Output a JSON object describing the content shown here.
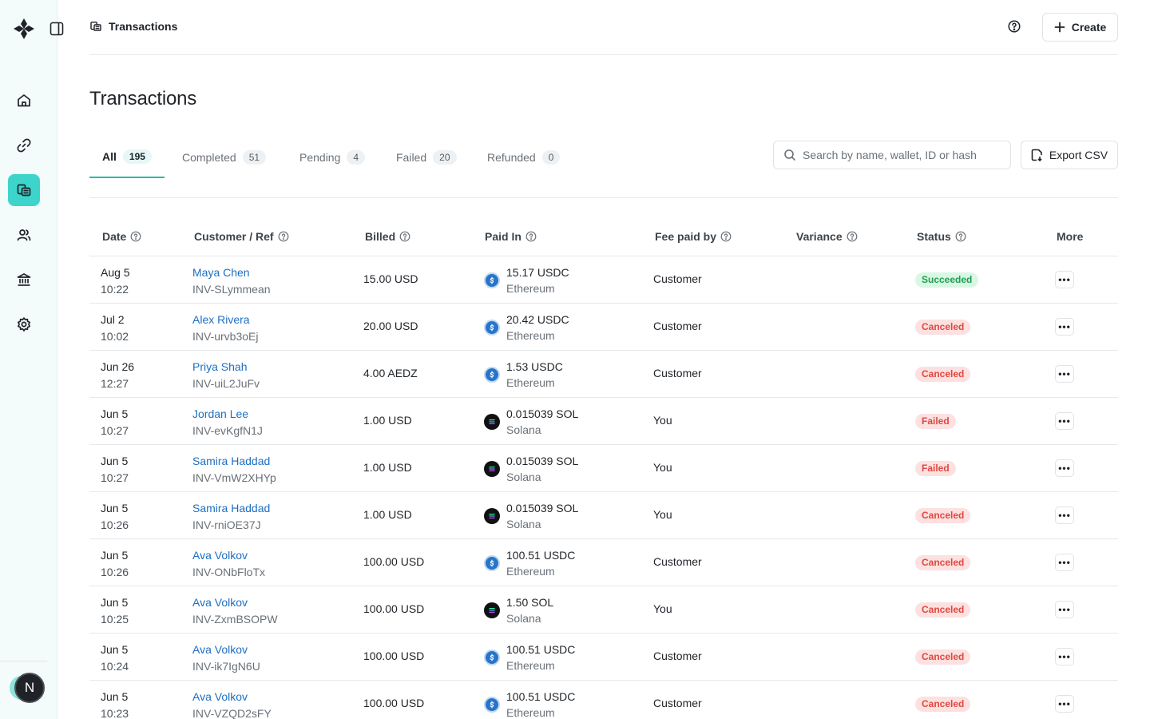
{
  "header": {
    "breadcrumb": "Transactions",
    "create_label": "Create"
  },
  "page": {
    "title": "Transactions"
  },
  "tabs": [
    {
      "label": "All",
      "count": "195",
      "active": true
    },
    {
      "label": "Completed",
      "count": "51",
      "active": false
    },
    {
      "label": "Pending",
      "count": "4",
      "active": false
    },
    {
      "label": "Failed",
      "count": "20",
      "active": false
    },
    {
      "label": "Refunded",
      "count": "0",
      "active": false
    }
  ],
  "search": {
    "placeholder": "Search by name, wallet, ID or hash",
    "value": ""
  },
  "export_label": "Export CSV",
  "user": {
    "initial": "N"
  },
  "table": {
    "columns": [
      "Date",
      "Customer / Ref",
      "Billed",
      "Paid In",
      "Fee paid by",
      "Variance",
      "Status",
      "More"
    ],
    "rows": [
      {
        "date": "Aug 5",
        "time": "10:22",
        "customer": "Maya Chen",
        "ref": "INV-SLymmean",
        "billed": "15.00 USD",
        "coin": "usdc",
        "paid": "15.17 USDC",
        "chain": "Ethereum",
        "fee": "Customer",
        "variance": "",
        "status": "Succeeded"
      },
      {
        "date": "Jul 2",
        "time": "10:02",
        "customer": "Alex Rivera",
        "ref": "INV-urvb3oEj",
        "billed": "20.00 USD",
        "coin": "usdc",
        "paid": "20.42 USDC",
        "chain": "Ethereum",
        "fee": "Customer",
        "variance": "",
        "status": "Canceled"
      },
      {
        "date": "Jun 26",
        "time": "12:27",
        "customer": "Priya Shah",
        "ref": "INV-uiL2JuFv",
        "billed": "4.00 AEDZ",
        "coin": "usdc",
        "paid": "1.53 USDC",
        "chain": "Ethereum",
        "fee": "Customer",
        "variance": "",
        "status": "Canceled"
      },
      {
        "date": "Jun 5",
        "time": "10:27",
        "customer": "Jordan Lee",
        "ref": "INV-evKgfN1J",
        "billed": "1.00 USD",
        "coin": "sol",
        "paid": "0.015039 SOL",
        "chain": "Solana",
        "fee": "You",
        "variance": "",
        "status": "Failed"
      },
      {
        "date": "Jun 5",
        "time": "10:27",
        "customer": "Samira Haddad",
        "ref": "INV-VmW2XHYp",
        "billed": "1.00 USD",
        "coin": "sol",
        "paid": "0.015039 SOL",
        "chain": "Solana",
        "fee": "You",
        "variance": "",
        "status": "Failed"
      },
      {
        "date": "Jun 5",
        "time": "10:26",
        "customer": "Samira Haddad",
        "ref": "INV-rniOE37J",
        "billed": "1.00 USD",
        "coin": "sol",
        "paid": "0.015039 SOL",
        "chain": "Solana",
        "fee": "You",
        "variance": "",
        "status": "Canceled"
      },
      {
        "date": "Jun 5",
        "time": "10:26",
        "customer": "Ava Volkov",
        "ref": "INV-ONbFloTx",
        "billed": "100.00 USD",
        "coin": "usdc",
        "paid": "100.51 USDC",
        "chain": "Ethereum",
        "fee": "Customer",
        "variance": "",
        "status": "Canceled"
      },
      {
        "date": "Jun 5",
        "time": "10:25",
        "customer": "Ava Volkov",
        "ref": "INV-ZxmBSOPW",
        "billed": "100.00 USD",
        "coin": "sol",
        "paid": "1.50 SOL",
        "chain": "Solana",
        "fee": "You",
        "variance": "",
        "status": "Canceled"
      },
      {
        "date": "Jun 5",
        "time": "10:24",
        "customer": "Ava Volkov",
        "ref": "INV-ik7IgN6U",
        "billed": "100.00 USD",
        "coin": "usdc",
        "paid": "100.51 USDC",
        "chain": "Ethereum",
        "fee": "Customer",
        "variance": "",
        "status": "Canceled"
      },
      {
        "date": "Jun 5",
        "time": "10:23",
        "customer": "Ava Volkov",
        "ref": "INV-VZQD2sFY",
        "billed": "100.00 USD",
        "coin": "usdc",
        "paid": "100.51 USDC",
        "chain": "Ethereum",
        "fee": "Customer",
        "variance": "",
        "status": "Canceled"
      }
    ]
  },
  "status_colors": {
    "Succeeded": {
      "bg": "#d9f7e3",
      "fg": "#1e9e55"
    },
    "Canceled": {
      "bg": "#fde0e0",
      "fg": "#e0483f"
    },
    "Failed": {
      "bg": "#fde0e0",
      "fg": "#e0483f"
    }
  },
  "colors": {
    "accent": "#3dd4cc",
    "link": "#1e6fc2"
  }
}
